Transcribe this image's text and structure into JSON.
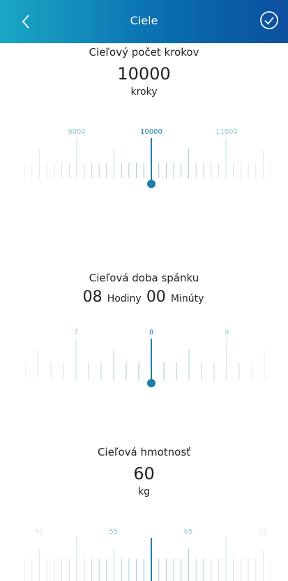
{
  "header": {
    "title": "Ciele",
    "back_icon": "back-chevron-icon",
    "confirm_icon": "check-circle-icon"
  },
  "steps": {
    "title": "Cieľový počet krokov",
    "value": "10000",
    "unit": "kroky",
    "ticks": [
      "9000",
      "10000",
      "11000"
    ]
  },
  "sleep": {
    "title": "Cieľová doba spánku",
    "hours": "08",
    "hours_label": "Hodiny",
    "minutes": "00",
    "minutes_label": "Minúty",
    "ticks": [
      "7",
      "8",
      "9"
    ]
  },
  "weight": {
    "title": "Cieľová hmotnosť",
    "value": "60",
    "unit": "kg",
    "ticks": [
      "45",
      "55",
      "65",
      "75"
    ]
  },
  "colors": {
    "accent": "#1a7fa6",
    "tick": "#bfe0ea",
    "header_start": "#1aa7c4",
    "header_end": "#0b4f9e"
  }
}
